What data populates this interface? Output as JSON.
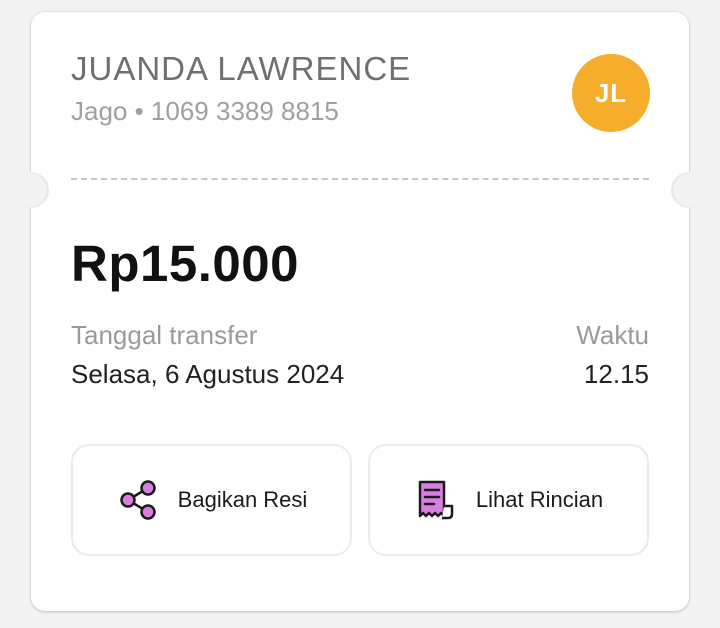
{
  "recipient": {
    "name": "JUANDA LAWRENCE",
    "account": "Jago • 1069 3389 8815",
    "initials": "JL"
  },
  "transfer": {
    "amount": "Rp15.000",
    "date_label": "Tanggal transfer",
    "date_value": "Selasa, 6 Agustus 2024",
    "time_label": "Waktu",
    "time_value": "12.15"
  },
  "actions": {
    "share_label": "Bagikan Resi",
    "share_icon": "share-icon",
    "detail_label": "Lihat Rincian",
    "detail_icon": "receipt-icon"
  },
  "colors": {
    "avatar": "#f6ad2b",
    "icon_accent": "#d97ee0",
    "icon_stroke": "#1b1b1b"
  }
}
